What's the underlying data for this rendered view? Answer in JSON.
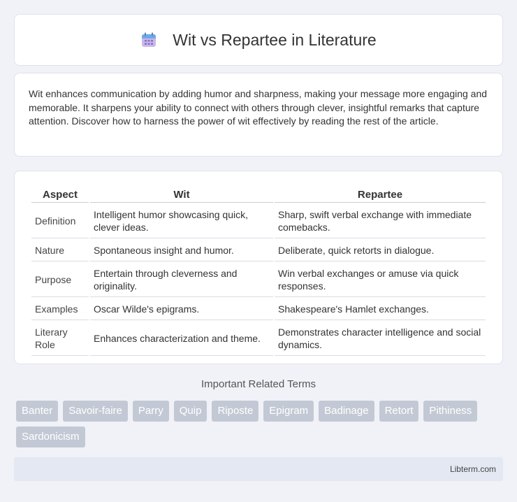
{
  "header": {
    "title": "Wit vs Repartee in Literature",
    "icon": "calendar-icon"
  },
  "intro": {
    "text": "Wit enhances communication by adding humor and sharpness, making your message more engaging and memorable. It sharpens your ability to connect with others through clever, insightful remarks that capture attention. Discover how to harness the power of wit effectively by reading the rest of the article."
  },
  "table": {
    "headers": [
      "Aspect",
      "Wit",
      "Repartee"
    ],
    "rows": [
      [
        "Definition",
        "Intelligent humor showcasing quick, clever ideas.",
        "Sharp, swift verbal exchange with immediate comebacks."
      ],
      [
        "Nature",
        "Spontaneous insight and humor.",
        "Deliberate, quick retorts in dialogue."
      ],
      [
        "Purpose",
        "Entertain through cleverness and originality.",
        "Win verbal exchanges or amuse via quick responses."
      ],
      [
        "Examples",
        "Oscar Wilde's epigrams.",
        "Shakespeare's Hamlet exchanges."
      ],
      [
        "Literary Role",
        "Enhances characterization and theme.",
        "Demonstrates character intelligence and social dynamics."
      ]
    ]
  },
  "related": {
    "title": "Important Related Terms",
    "terms": [
      "Banter",
      "Savoir-faire",
      "Parry",
      "Quip",
      "Riposte",
      "Epigram",
      "Badinage",
      "Retort",
      "Pithiness",
      "Sardonicism"
    ]
  },
  "footer": {
    "brand": "Libterm.com"
  },
  "colors": {
    "background": "#f0f2f7",
    "tag": "#c3c9d4",
    "footer": "#e3e8f3"
  }
}
